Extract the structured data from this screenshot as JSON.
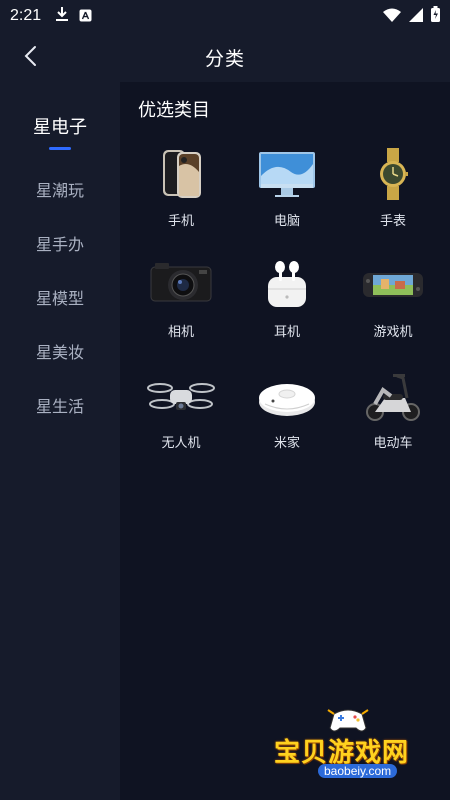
{
  "status_bar": {
    "time": "2:21"
  },
  "header": {
    "title": "分类"
  },
  "sidebar": {
    "items": [
      {
        "label": "星电子",
        "active": true
      },
      {
        "label": "星潮玩"
      },
      {
        "label": "星手办"
      },
      {
        "label": "星模型"
      },
      {
        "label": "星美妆"
      },
      {
        "label": "星生活"
      }
    ]
  },
  "main": {
    "section_title": "优选类目",
    "categories": [
      {
        "label": "手机",
        "icon": "phone-icon"
      },
      {
        "label": "电脑",
        "icon": "desktop-computer-icon"
      },
      {
        "label": "手表",
        "icon": "watch-icon"
      },
      {
        "label": "相机",
        "icon": "camera-icon"
      },
      {
        "label": "耳机",
        "icon": "earbuds-icon"
      },
      {
        "label": "游戏机",
        "icon": "game-console-icon"
      },
      {
        "label": "无人机",
        "icon": "drone-icon"
      },
      {
        "label": "米家",
        "icon": "robot-vacuum-icon"
      },
      {
        "label": "电动车",
        "icon": "electric-scooter-icon"
      }
    ]
  },
  "watermark": {
    "text": "宝贝游戏网",
    "url": "baobeiy.com"
  },
  "colors": {
    "accent": "#2f6bff",
    "background": "#161b2b",
    "panel": "#0f1322"
  }
}
